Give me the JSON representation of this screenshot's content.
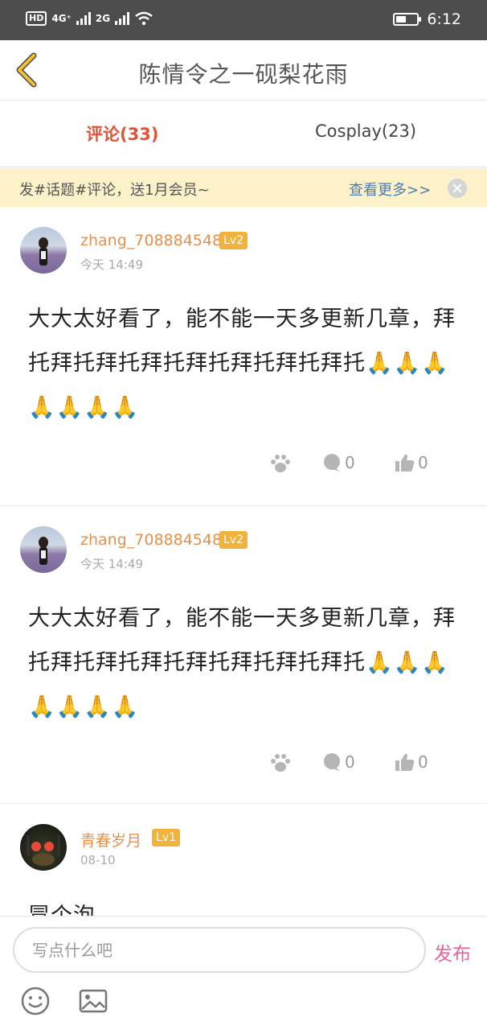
{
  "status_bar": {
    "left_badge": "HD",
    "net1": "4G⁺",
    "net2": "2G",
    "time": "6:12"
  },
  "nav": {
    "title": "陈情令之一砚梨花雨"
  },
  "tabs": [
    {
      "label": "评论(33)",
      "active": true
    },
    {
      "label": "Cosplay(23)",
      "active": false
    }
  ],
  "promo": {
    "text": "发#话题#评论，送1月会员~",
    "more": "查看更多>>"
  },
  "comments": [
    {
      "username": "zhang_708884548",
      "level": "Lv2",
      "time": "今天 14:49",
      "content": "大大太好看了，能不能一天多更新几章，拜托拜托拜托拜托拜托拜托拜托拜托🙏🙏🙏🙏🙏🙏🙏",
      "reply_count": "0",
      "like_count": "0"
    },
    {
      "username": "zhang_708884548",
      "level": "Lv2",
      "time": "今天 14:49",
      "content": "大大太好看了，能不能一天多更新几章，拜托拜托拜托拜托拜托拜托拜托拜托🙏🙏🙏🙏🙏🙏🙏",
      "reply_count": "0",
      "like_count": "0"
    },
    {
      "username": "青春岁月",
      "level": "Lv1",
      "time": "08-10",
      "content": "冒个泡"
    }
  ],
  "composer": {
    "placeholder": "写点什么吧",
    "publish": "发布"
  },
  "colors": {
    "accent_red": "#e0533a",
    "username_orange": "#e7904e",
    "level_badge": "#f2b33d",
    "promo_bg": "#fcf1c9",
    "publish_pink": "#e3679b"
  }
}
